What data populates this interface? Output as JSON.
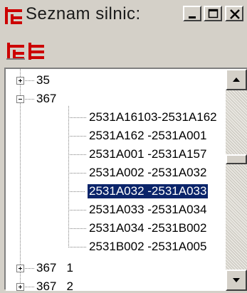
{
  "window": {
    "title": "Seznam silnic:",
    "brand_color": "#cc0000",
    "buttons": {
      "minimize": "minimize-icon",
      "maximize": "maximize-icon",
      "close": "close-icon"
    }
  },
  "toolbar": {
    "items": [
      {
        "name": "tree-view-tool",
        "icon": "tree-icon"
      },
      {
        "name": "list-view-tool",
        "icon": "list-icon"
      }
    ]
  },
  "tree": {
    "items": [
      {
        "label": "35",
        "level": 0,
        "expanded": false
      },
      {
        "label": "367",
        "level": 0,
        "expanded": true
      },
      {
        "label": "2531A16103-2531A162",
        "level": 1
      },
      {
        "label": "2531A162  -2531A001",
        "level": 1
      },
      {
        "label": "2531A001  -2531A157",
        "level": 1
      },
      {
        "label": "2531A002  -2531A032",
        "level": 1
      },
      {
        "label": "2531A032  -2531A033",
        "level": 1,
        "selected": true
      },
      {
        "label": "2531A033  -2531A034",
        "level": 1
      },
      {
        "label": "2531A034  -2531B002",
        "level": 1
      },
      {
        "label": "2531B002  -2531A005",
        "level": 1
      },
      {
        "label": "367   1",
        "level": 0,
        "expanded": false
      },
      {
        "label": "367   2",
        "level": 0,
        "expanded": false
      }
    ],
    "selection_color": "#0a246a"
  }
}
